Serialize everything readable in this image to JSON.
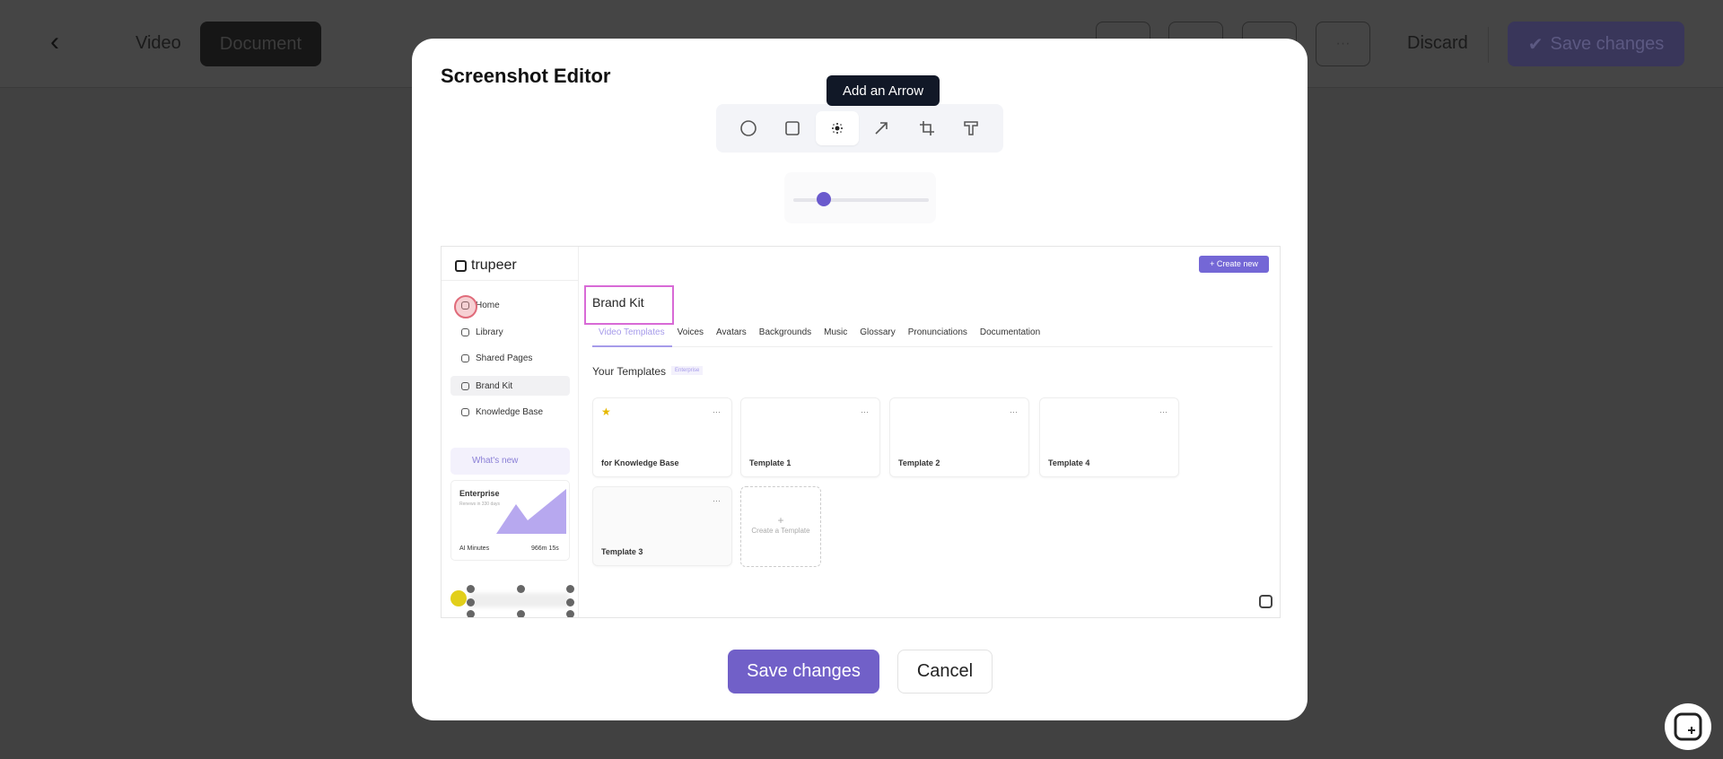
{
  "header": {
    "back_icon": "chevron-left-icon",
    "tabs": [
      "Video",
      "Document"
    ],
    "more_label": "···",
    "discard": "Discard",
    "save": "Save changes"
  },
  "modal": {
    "title": "Screenshot Editor",
    "tooltip": "Add an Arrow",
    "tools": [
      "circle-icon",
      "square-icon",
      "blur-icon",
      "arrow-icon",
      "crop-icon",
      "text-icon"
    ],
    "slider_value": 0.2,
    "accent": "#7160c8",
    "save": "Save changes",
    "cancel": "Cancel"
  },
  "screenshot": {
    "logo": "trupeer",
    "nav": [
      "Home",
      "Library",
      "Shared Pages",
      "Brand Kit",
      "Knowledge Base"
    ],
    "whats_new": "What's new",
    "plan": {
      "name": "Enterprise",
      "renew": "Renews in 330 days",
      "minutes_label": "AI Minutes",
      "minutes_value": "966m 15s"
    },
    "create_new": "+ Create new",
    "page_title": "Brand Kit",
    "tabs": [
      "Video Templates",
      "Voices",
      "Avatars",
      "Backgrounds",
      "Music",
      "Glossary",
      "Pronunciations",
      "Documentation"
    ],
    "section": "Your Templates",
    "badge": "Enterprise",
    "templates": [
      "for Knowledge Base",
      "Template 1",
      "Template 2",
      "Template 4",
      "Template 3"
    ],
    "create_template": "Create a Template"
  }
}
